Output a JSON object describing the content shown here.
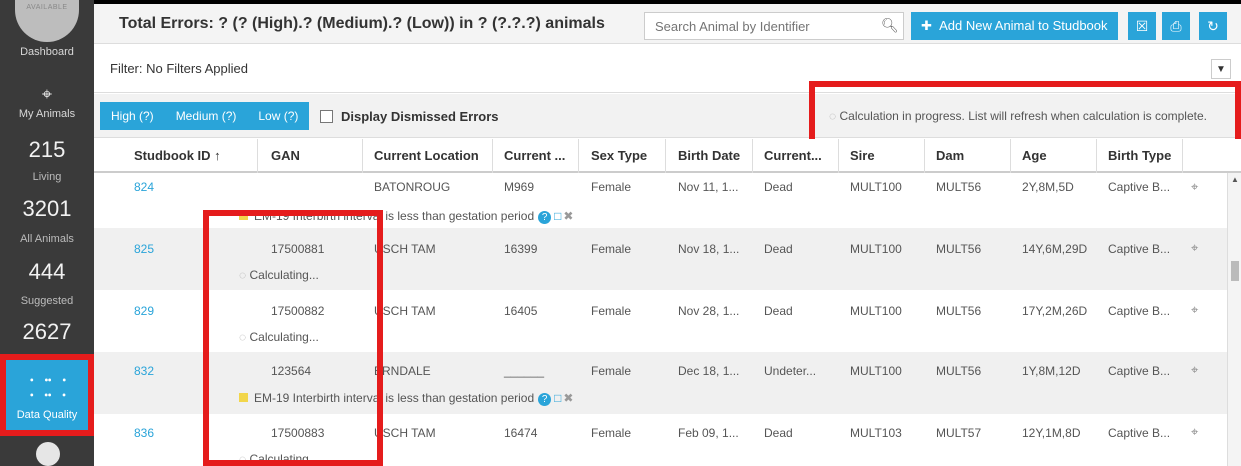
{
  "sidebar": {
    "avatar_text": "AVAILABLE",
    "dashboard": "Dashboard",
    "my_animals": "My Animals",
    "living_count": "215",
    "living_label": "Living",
    "all_count": "3201",
    "all_label": "All Animals",
    "suggested_count": "444",
    "suggested_label": "Suggested",
    "dq_count": "2627",
    "data_quality": "Data Quality"
  },
  "header": {
    "title": "Total Errors: ? (? (High).? (Medium).? (Low)) in ? (?.?.?) animals",
    "search_placeholder": "Search Animal by Identifier",
    "add_label": "Add New Animal to Studbook"
  },
  "filter": {
    "text": "Filter: No Filters Applied"
  },
  "severity": {
    "high": "High (?)",
    "medium": "Medium (?)",
    "low": "Low (?)",
    "dismissed_label": "Display Dismissed Errors",
    "calc_message": "Calculation in progress. List will refresh when calculation is complete."
  },
  "columns": [
    "Studbook ID ↑",
    "GAN",
    "Current Location",
    "Current ...",
    "Sex Type",
    "Birth Date",
    "Current...",
    "Sire",
    "Dam",
    "Age",
    "Birth Type"
  ],
  "rows": [
    {
      "id": "824",
      "gan": "",
      "loc": "BATONROUG",
      "cur": "M969",
      "sex": "Female",
      "birth": "Nov 11, 1...",
      "status": "Dead",
      "sire": "MULT100",
      "dam": "MULT56",
      "age": "2Y,8M,5D",
      "btype": "Captive B...",
      "sub": "EM-19 Interbirth interval is less than gestation period"
    },
    {
      "id": "825",
      "gan": "17500881",
      "loc": "USCH TAM",
      "cur": "16399",
      "sex": "Female",
      "birth": "Nov 18, 1...",
      "status": "Dead",
      "sire": "MULT100",
      "dam": "MULT56",
      "age": "14Y,6M,29D",
      "btype": "Captive B...",
      "sub": "Calculating..."
    },
    {
      "id": "829",
      "gan": "17500882",
      "loc": "USCH TAM",
      "cur": "16405",
      "sex": "Female",
      "birth": "Nov 28, 1...",
      "status": "Dead",
      "sire": "MULT100",
      "dam": "MULT56",
      "age": "17Y,2M,26D",
      "btype": "Captive B...",
      "sub": "Calculating..."
    },
    {
      "id": "832",
      "gan": "123564",
      "loc": "ERNDALE",
      "cur": "______",
      "sex": "Female",
      "birth": "Dec 18, 1...",
      "status": "Undeter...",
      "sire": "MULT100",
      "dam": "MULT56",
      "age": "1Y,8M,12D",
      "btype": "Captive B...",
      "sub": "EM-19 Interbirth interval is less than gestation period"
    },
    {
      "id": "836",
      "gan": "17500883",
      "loc": "USCH TAM",
      "cur": "16474",
      "sex": "Female",
      "birth": "Feb 09, 1...",
      "status": "Dead",
      "sire": "MULT103",
      "dam": "MULT57",
      "age": "12Y,1M,8D",
      "btype": "Captive B...",
      "sub": "Calculating..."
    }
  ]
}
